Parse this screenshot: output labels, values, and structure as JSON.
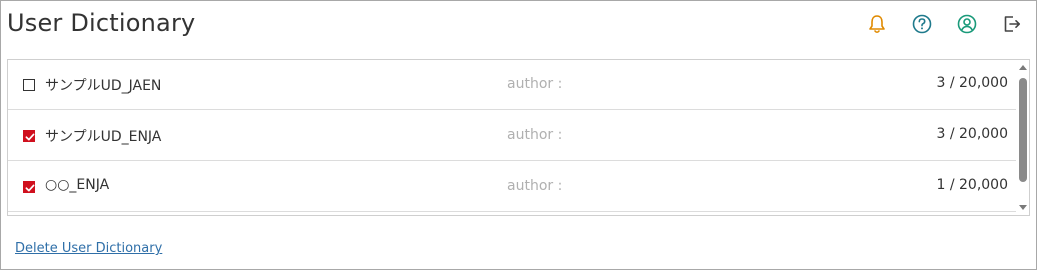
{
  "header": {
    "title": "User Dictionary",
    "icons": [
      {
        "name": "bell-icon",
        "color": "#e08a00"
      },
      {
        "name": "help-icon",
        "color": "#1f7a8c"
      },
      {
        "name": "user-icon",
        "color": "#1a9a7a"
      },
      {
        "name": "logout-icon",
        "color": "#444444"
      }
    ]
  },
  "dictionaries": [
    {
      "name": "サンプルUD_JAEN",
      "author": "author :",
      "count": "3 / 20,000",
      "checked": false
    },
    {
      "name": "サンプルUD_ENJA",
      "author": "author :",
      "count": "3 / 20,000",
      "checked": true
    },
    {
      "name": "○○_ENJA",
      "author": "author :",
      "count": "1 / 20,000",
      "checked": true
    }
  ],
  "footer": {
    "delete_label": "Delete User Dictionary"
  },
  "colors": {
    "checkbox_checked": "#d0101e",
    "link": "#2f6fa8"
  }
}
